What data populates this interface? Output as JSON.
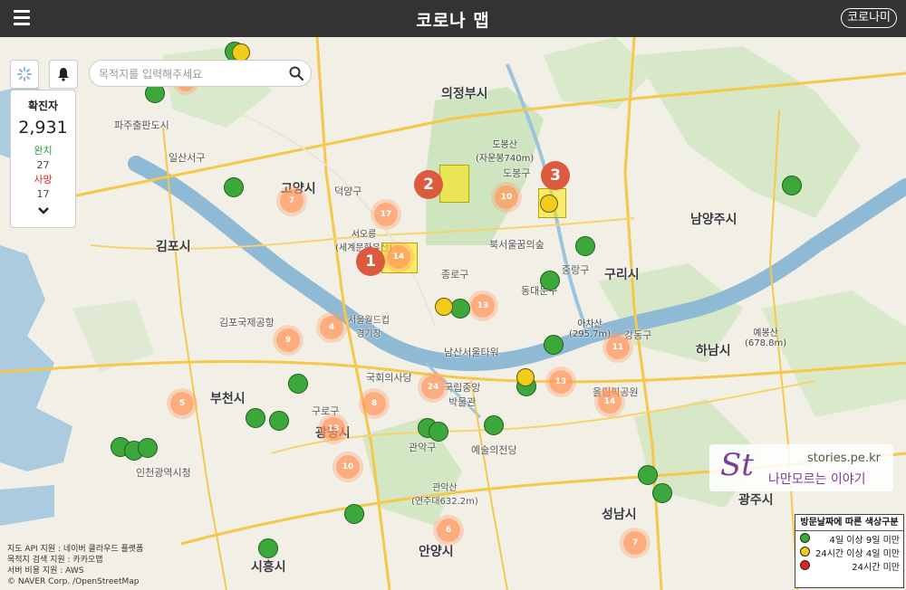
{
  "header": {
    "title": "코로나 맵",
    "right_button": "코로나미"
  },
  "search": {
    "placeholder": "목적지를 입력해주세요"
  },
  "stats": {
    "confirmed_label": "확진자",
    "confirmed": "2,931",
    "recovered_label": "완치",
    "recovered": "27",
    "deaths_label": "사망",
    "deaths": "17"
  },
  "legend": {
    "title": "방문날짜에 따른 색상구분",
    "items": [
      {
        "label": "4일 이상 9일 미만",
        "color": "#3ca83c"
      },
      {
        "label": "24시간 이상 4일 미만",
        "color": "#f2cc1a"
      },
      {
        "label": "24시간 미만",
        "color": "#e0221c"
      }
    ]
  },
  "attribution": [
    "지도 API 지원 : 네이버 클라우드 플랫폼",
    "목적지 검색 지원 : 카카오맵",
    "서버 비용 지원 : AWS",
    "© NAVER Corp. /OpenStreetMap"
  ],
  "watermark": {
    "logo": "St",
    "url": "stories.pe.kr",
    "text": "나만모르는 이야기"
  },
  "route_badges": [
    "1",
    "2",
    "3"
  ],
  "clusters": [
    "14",
    "17",
    "7",
    "10",
    "13",
    "4",
    "9",
    "5",
    "8",
    "24",
    "13",
    "13",
    "10",
    "6",
    "11",
    "13",
    "14",
    "7"
  ],
  "places": {
    "uijeongbu": "의정부시",
    "goyang": "고양시",
    "gimpo": "김포시",
    "namyangju": "남양주시",
    "guri": "구리시",
    "hanam": "하남시",
    "bucheon": "부천시",
    "gwangmyeong": "광명시",
    "seongnam": "성남시",
    "anyang": "안양시",
    "siheung": "시흥시",
    "gwangju": "광주시",
    "seooreung": "서오릉\n(세계문화유산)",
    "dobongsan": "도봉산\n(자운봉740m)",
    "achasan": "아차산\n(295.7m)",
    "yebongsan": "예봉산\n(678.8m)",
    "namsan": "남산서울타워",
    "gukhoe": "국회의사당",
    "museum": "국립중앙\n박물관",
    "gwanaksan": "관악산\n(연주대632.2m)",
    "bukseoul": "북서울꿈의숲",
    "olympic": "올림픽공원",
    "paju": "파주출판도시",
    "gimpo_airport": "김포국제공항",
    "seoul_park": "서울월드컵\n경기장",
    "ilsan": "일산서구",
    "deogyang": "덕양구",
    "dobong": "도봉구",
    "junggu": "중랑구",
    "jongno": "종로구",
    "gangdong": "강동구",
    "guro": "구로구",
    "gwanak": "관악구",
    "dongducheon": "동대문구",
    "incheon": "인천광역시청",
    "yesul": "예술의전당"
  }
}
